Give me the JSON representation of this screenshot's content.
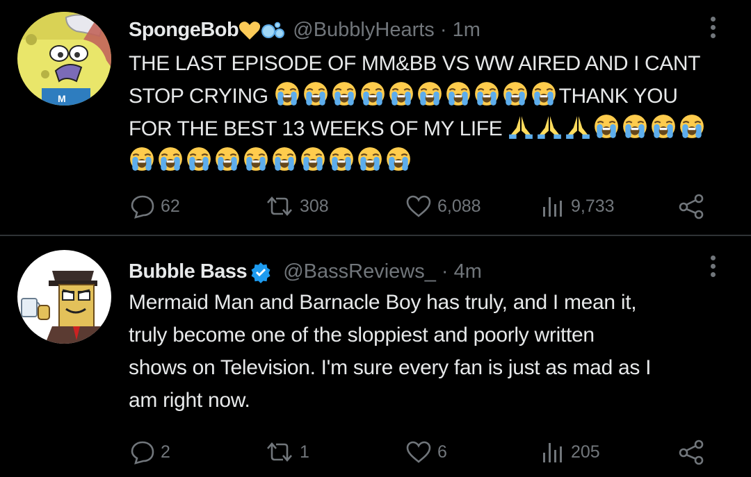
{
  "tweets": [
    {
      "display_name": "SpongeBob",
      "name_emojis": [
        "yellow-heart",
        "bubbles"
      ],
      "handle": "@BubblyHearts",
      "time": "1m",
      "text_lines": [
        "THE LAST EPISODE OF MM&BB VS WW AIRED AND I CANT",
        "STOP CRYING",
        "THANK YOU",
        "FOR THE BEST 13 WEEKS OF MY LIFE"
      ],
      "replies": "62",
      "retweets": "308",
      "likes": "6,088",
      "views": "9,733"
    },
    {
      "display_name": "Bubble Bass",
      "verified": true,
      "handle": "@BassReviews_",
      "time": "4m",
      "text_lines": [
        "Mermaid Man and Barnacle Boy has truly, and I mean it,",
        "truly become one of the sloppiest and poorly written",
        "shows on Television. I'm sure every fan is just as mad as I",
        "am right now."
      ],
      "replies": "2",
      "retweets": "1",
      "likes": "6",
      "views": "205"
    }
  ],
  "colors": {
    "background": "#000000",
    "text": "#e7e9ea",
    "muted": "#71767b",
    "verified": "#1d9bf0",
    "divider": "#2f3336"
  },
  "icons": [
    "reply-icon",
    "retweet-icon",
    "like-icon",
    "views-icon",
    "share-icon",
    "more-icon",
    "verified-icon",
    "crying-emoji",
    "praying-hands-emoji"
  ]
}
